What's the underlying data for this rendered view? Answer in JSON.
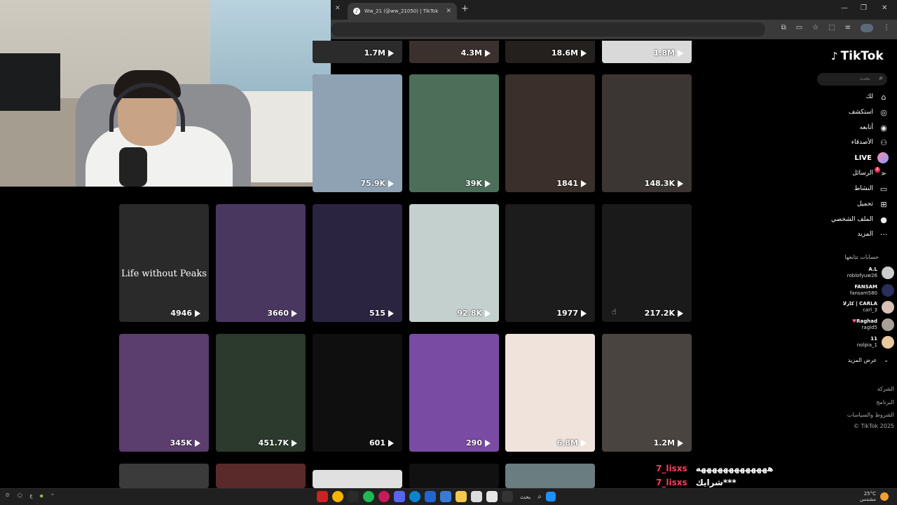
{
  "browser": {
    "tab_title": "Ww_21 (@ww_21050) | TikTok",
    "new_tab": "+",
    "window_minimize": "—",
    "window_restore": "❐",
    "window_close": "✕"
  },
  "tiktok": {
    "logo": "TikTok",
    "search_placeholder": "بحث",
    "nav": [
      {
        "label": "لك",
        "icon": "home-icon"
      },
      {
        "label": "استكشف",
        "icon": "explore-icon"
      },
      {
        "label": "أتابعه",
        "icon": "following-icon"
      },
      {
        "label": "الأصدقاء",
        "icon": "friends-icon"
      },
      {
        "label": "LIVE",
        "icon": "live-icon"
      },
      {
        "label": "الرسائل",
        "icon": "messages-icon",
        "badge": "4"
      },
      {
        "label": "النشاط",
        "icon": "activity-icon"
      },
      {
        "label": "تحميل",
        "icon": "upload-icon"
      },
      {
        "label": "الملف الشخصي",
        "icon": "profile-icon"
      },
      {
        "label": "المزيد",
        "icon": "more-icon"
      }
    ],
    "following_title": "حسابات تتابعها",
    "accounts": [
      {
        "name": "A.L",
        "handle": "roblofyuw26",
        "color": "#cccccc"
      },
      {
        "name": "FANSAM",
        "handle": "fansam580",
        "color": "#2a2e5a"
      },
      {
        "name": "كارلا | CARLA",
        "handle": "carl_3",
        "color": "#d9c2b6"
      },
      {
        "name": "Raghad",
        "handle": "ragld5",
        "color": "#a8a096"
      },
      {
        "name": "11",
        "handle": "nolpia_1",
        "color": "#e8c9a0"
      }
    ],
    "see_more": "عرض المزيد",
    "footer": [
      "الشركة",
      "البرنامج",
      "الشروط والسياسات",
      "© TikTok 2025"
    ]
  },
  "videos": {
    "row0": [
      {
        "views": "1.7M",
        "bg": "#2b2b2b"
      },
      {
        "views": "4.3M",
        "bg": "#3a302d"
      },
      {
        "views": "18.6M",
        "bg": "#24201e"
      },
      {
        "views": "1.8M",
        "bg": "#d9d9d9"
      }
    ],
    "row1": [
      {
        "views": "75.9K",
        "bg": "#8ea2b3"
      },
      {
        "views": "39K",
        "bg": "#4d6f5a"
      },
      {
        "views": "1841",
        "bg": "#3a2f2a"
      },
      {
        "views": "148.3K",
        "bg": "#3b3633"
      }
    ],
    "row2": [
      {
        "views": "4946",
        "bg": "#2a2a2a",
        "text": "Life without Peaks"
      },
      {
        "views": "3660",
        "bg": "#4a3760"
      },
      {
        "views": "515",
        "bg": "#2a2440"
      },
      {
        "views": "92.8K",
        "bg": "#c4d0cd"
      },
      {
        "views": "1977",
        "bg": "#1c1c1c"
      },
      {
        "views": "217.2K",
        "bg": "#1a1a1a"
      }
    ],
    "row3": [
      {
        "views": "345K",
        "bg": "#5b3d6e"
      },
      {
        "views": "451.7K",
        "bg": "#2b3a2c"
      },
      {
        "views": "601",
        "bg": "#0f0f0f"
      },
      {
        "views": "290",
        "bg": "#7a4ba3"
      },
      {
        "views": "6.8M",
        "bg": "#efe3dc"
      },
      {
        "views": "1.2M",
        "bg": "#4a4440"
      }
    ]
  },
  "chat": [
    {
      "user": "7_lisxs",
      "msg": "هههههههههههههه"
    },
    {
      "user": "7_lisxs",
      "msg": "شرايك***"
    }
  ],
  "taskbar": {
    "search_label": "بحث",
    "weather": "25°C",
    "weather_desc": "مشمس"
  }
}
